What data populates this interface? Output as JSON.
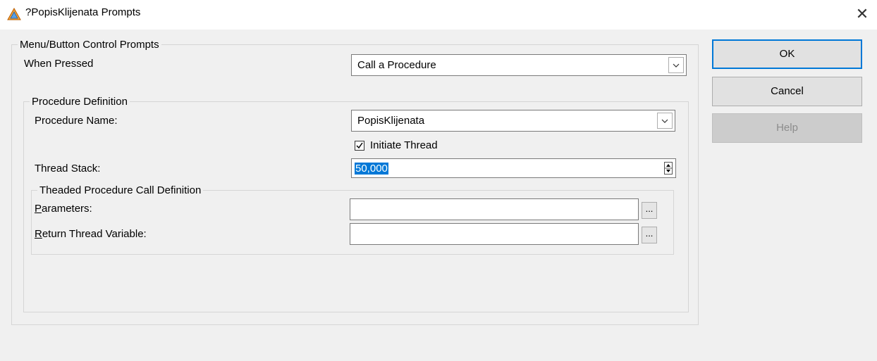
{
  "window": {
    "title": "?PopisKlijenata Prompts",
    "icon": "app-icon",
    "close_glyph": "✕"
  },
  "menu_group": {
    "legend": "Menu/Button Control Prompts",
    "when_pressed_label": "When Pressed",
    "when_pressed_value": "Call a Procedure"
  },
  "procedure_group": {
    "legend": "Procedure Definition",
    "procedure_name_label": "Procedure Name:",
    "procedure_name_value": "PopisKlijenata",
    "initiate_thread_label": "Initiate Thread",
    "initiate_thread_checked": true,
    "thread_stack_label": "Thread Stack:",
    "thread_stack_value": "50,000"
  },
  "threaded_group": {
    "legend": "Theaded Procedure Call Definition",
    "parameters_label_accel": "P",
    "parameters_label_rest": "arameters:",
    "parameters_value": "",
    "return_label_accel": "R",
    "return_label_rest": "eturn Thread Variable:",
    "return_value": "",
    "ellipsis_label": "..."
  },
  "buttons": {
    "ok": "OK",
    "cancel": "Cancel",
    "help": "Help"
  },
  "colors": {
    "accent": "#0078d7",
    "selection": "#0078d7"
  }
}
